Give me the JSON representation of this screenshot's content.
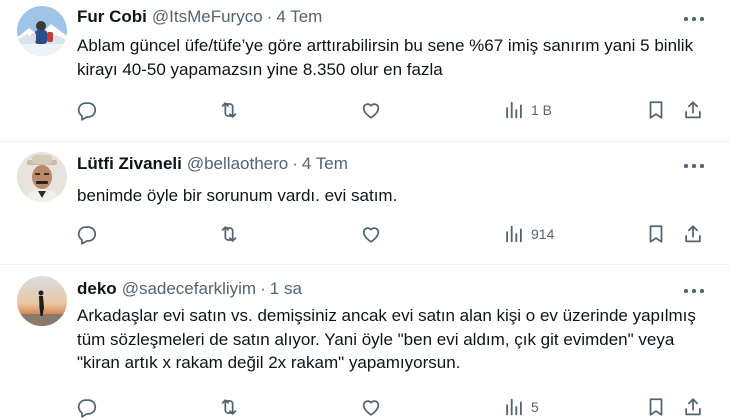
{
  "tweets": [
    {
      "name": "Fur Cobi",
      "handle": "@ItsMeFuryco",
      "separator": "·",
      "time": "4 Tem",
      "text": "Ablam güncel üfe/tüfe’ye göre arttırabilirsin bu sene %67 imiş sanırım yani 5 binlik kirayı 40-50 yapamazsın yine 8.350 olur en fazla",
      "views": "1 B",
      "avatar": "snow-mountain-photo"
    },
    {
      "name": "Lütfi Zivaneli",
      "handle": "@bellaothero",
      "separator": "·",
      "time": "4 Tem",
      "text": "benimde öyle bir sorunum vardı. evi satım.",
      "views": "914",
      "avatar": "man-with-hat-photo"
    },
    {
      "name": "deko",
      "handle": "@sadecefarkliyim",
      "separator": "·",
      "time": "1 sa",
      "text": "Arkadaşlar evi satın vs. demişsiniz ancak evi satın alan kişi o ev üzerinde yapılmış tüm sözleşmeleri de satın alıyor. Yani öyle \"ben evi aldım, çık git evimden\" veya \"kiran artık x rakam değil 2x rakam\" yapamıyorsun.",
      "views": "5",
      "avatar": "sunset-silhouette-photo"
    }
  ],
  "colors": {
    "text": "#0f1419",
    "secondary": "#536471",
    "divider": "#eff3f4"
  }
}
